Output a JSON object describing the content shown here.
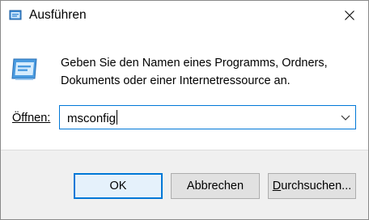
{
  "window": {
    "title": "Ausführen",
    "close_icon": "close-icon",
    "app_icon": "run-dialog-icon"
  },
  "content": {
    "icon": "run-dialog-icon",
    "description": "Geben Sie den Namen eines Programms, Ordners, Dokuments oder einer Internetressource an.",
    "open_label": "Öffnen:",
    "open_value": "msconfig"
  },
  "buttons": {
    "ok": "OK",
    "cancel": "Abbrechen",
    "browse_prefix": "D",
    "browse_rest": "urchsuchen..."
  },
  "colors": {
    "accent": "#0078d7",
    "footer_bg": "#f0f0f0"
  }
}
